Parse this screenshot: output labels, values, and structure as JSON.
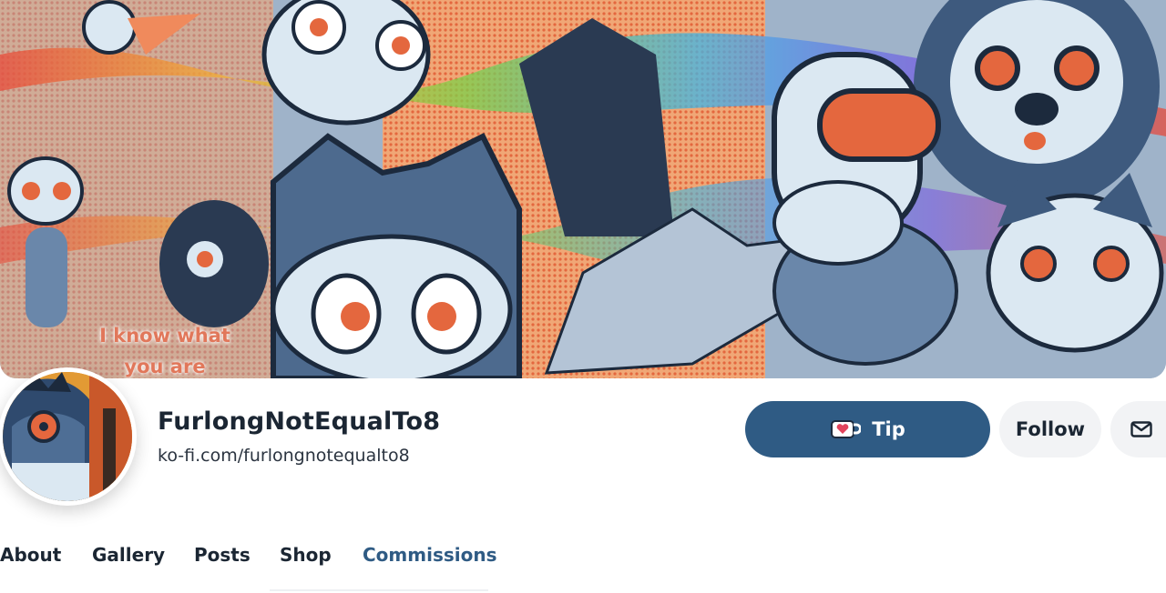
{
  "banner": {
    "caption_line1": "I know what",
    "caption_line2": "you are"
  },
  "profile": {
    "name": "FurlongNotEqualTo8",
    "url": "ko-fi.com/furlongnotequalto8"
  },
  "actions": {
    "tip_label": "Tip",
    "follow_label": "Follow",
    "message_icon": "envelope-icon",
    "tip_icon": "coffee-cup-heart-icon"
  },
  "tabs": [
    {
      "label": "About",
      "active": false
    },
    {
      "label": "Gallery",
      "active": false
    },
    {
      "label": "Posts",
      "active": false
    },
    {
      "label": "Shop",
      "active": false
    },
    {
      "label": "Commissions",
      "active": true
    }
  ],
  "colors": {
    "accent": "#2f5b84",
    "button_grey": "#f2f3f5",
    "text": "#1b2633",
    "caption": "#e1775a"
  }
}
